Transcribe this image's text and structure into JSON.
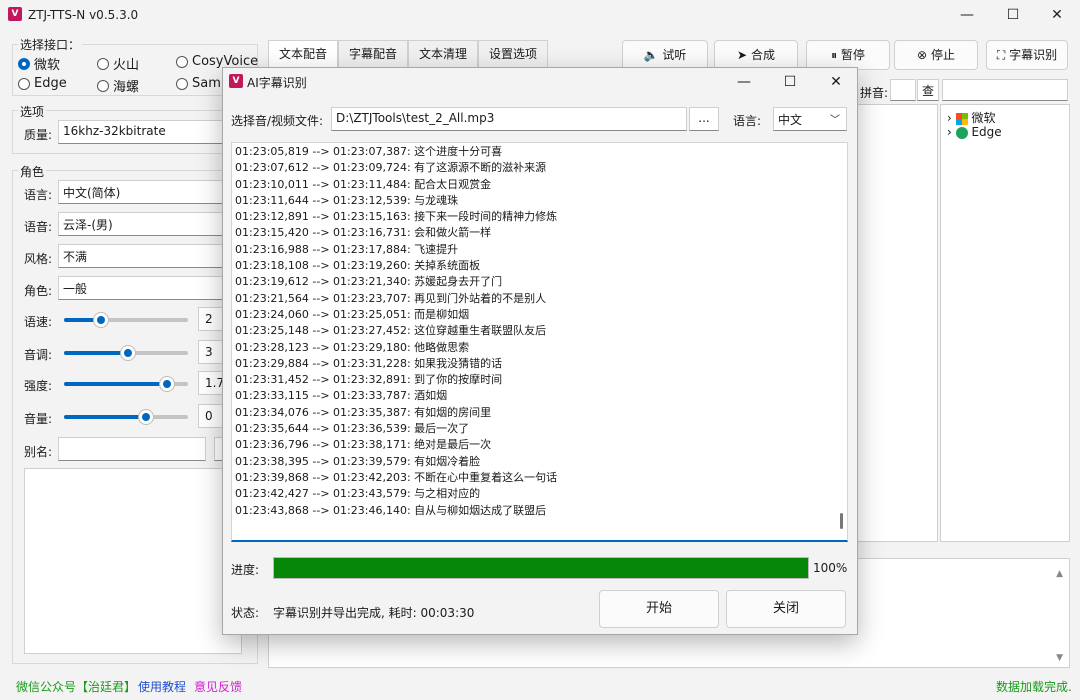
{
  "window": {
    "title": "ZTJ-TTS-N v0.5.3.0",
    "icon_text": "V",
    "minimize": "—",
    "maximize": "☐",
    "close": "✕"
  },
  "interface_group": {
    "title": "选择接口：",
    "options": [
      "微软",
      "火山",
      "CosyVoice",
      "Edge",
      "海螺",
      "Samb"
    ],
    "selected": "微软"
  },
  "options_group": {
    "title": "选项",
    "quality_label": "质量:",
    "quality_value": "16khz-32kbitrate"
  },
  "role_group": {
    "title": "角色",
    "language_label": "语言:",
    "language_value": "中文(简体)",
    "voice_label": "语音:",
    "voice_value": "云泽-(男)",
    "style_label": "风格:",
    "style_value": "不满",
    "role_label": "角色:",
    "role_value": "一般",
    "speed_label": "语速:",
    "speed_value": "2",
    "speed_level": 0.3,
    "pitch_label": "音调:",
    "pitch_value": "3",
    "pitch_level": 0.52,
    "intensity_label": "强度:",
    "intensity_value": "1.7",
    "intensity_level": 0.83,
    "volume_label": "音量:",
    "volume_value": "0",
    "volume_level": 0.66,
    "alias_label": "别名:"
  },
  "tabs": [
    "文本配音",
    "字幕配音",
    "文本清理",
    "设置选项"
  ],
  "toolbar": {
    "listen": "试听",
    "synthesize": "合成",
    "pause": "暂停",
    "stop": "停止",
    "subtitle_recognize": "字幕识别"
  },
  "pinyin": {
    "label": "拼音:",
    "search_button": "查"
  },
  "tree": {
    "items": [
      "微软",
      "Edge"
    ]
  },
  "footer": {
    "wechat": "微信公众号【治廷君】",
    "tutorial": "使用教程",
    "feedback": "意见反馈",
    "status": "数据加载完成."
  },
  "dialog": {
    "title": "AI字幕识别",
    "file_label": "选择音/视频文件:",
    "file_value": "D:\\ZTJTools\\test_2_All.mp3",
    "browse_button": "...",
    "language_label": "语言:",
    "language_value": "中文",
    "log_lines": [
      "01:23:05,819 --> 01:23:07,387:  这个进度十分可喜",
      "01:23:07,612 --> 01:23:09,724:  有了这源源不断的滋补来源",
      "01:23:10,011 --> 01:23:11,484:  配合太日观赏金",
      "01:23:11,644 --> 01:23:12,539:  与龙魂珠",
      "01:23:12,891 --> 01:23:15,163:  接下来一段时间的精神力修炼",
      "01:23:15,420 --> 01:23:16,731:  会和做火箭一样",
      "01:23:16,988 --> 01:23:17,884:  飞速提升",
      "01:23:18,108 --> 01:23:19,260:  关掉系统面板",
      "01:23:19,612 --> 01:23:21,340:  苏媛起身去开了门",
      "01:23:21,564 --> 01:23:23,707:  再见到门外站着的不是别人",
      "01:23:24,060 --> 01:23:25,051:  而是柳如烟",
      "01:23:25,148 --> 01:23:27,452:  这位穿越重生者联盟队友后",
      "01:23:28,123 --> 01:23:29,180:  他略做思索",
      "01:23:29,884 --> 01:23:31,228:  如果我没猜错的话",
      "01:23:31,452 --> 01:23:32,891:  到了你的按摩时间",
      "01:23:33,115 --> 01:23:33,787:  酒如烟",
      "01:23:34,076 --> 01:23:35,387:  有如烟的房间里",
      "01:23:35,644 --> 01:23:36,539:  最后一次了",
      "01:23:36,796 --> 01:23:38,171:  绝对是最后一次",
      "01:23:38,395 --> 01:23:39,579:  有如烟冷着脸",
      "01:23:39,868 --> 01:23:42,203:  不断在心中重复着这么一句话",
      "01:23:42,427 --> 01:23:43,579:  与之相对应的",
      "01:23:43,868 --> 01:23:46,140:  自从与柳如烟达成了联盟后"
    ],
    "progress_label": "进度:",
    "progress_value": 1.0,
    "progress_text": "100%",
    "status_label": "状态:",
    "status_value": "字幕识别并导出完成, 耗时: 00:03:30",
    "start_button": "开始",
    "close_button": "关闭",
    "progress_color": "#06870a"
  }
}
